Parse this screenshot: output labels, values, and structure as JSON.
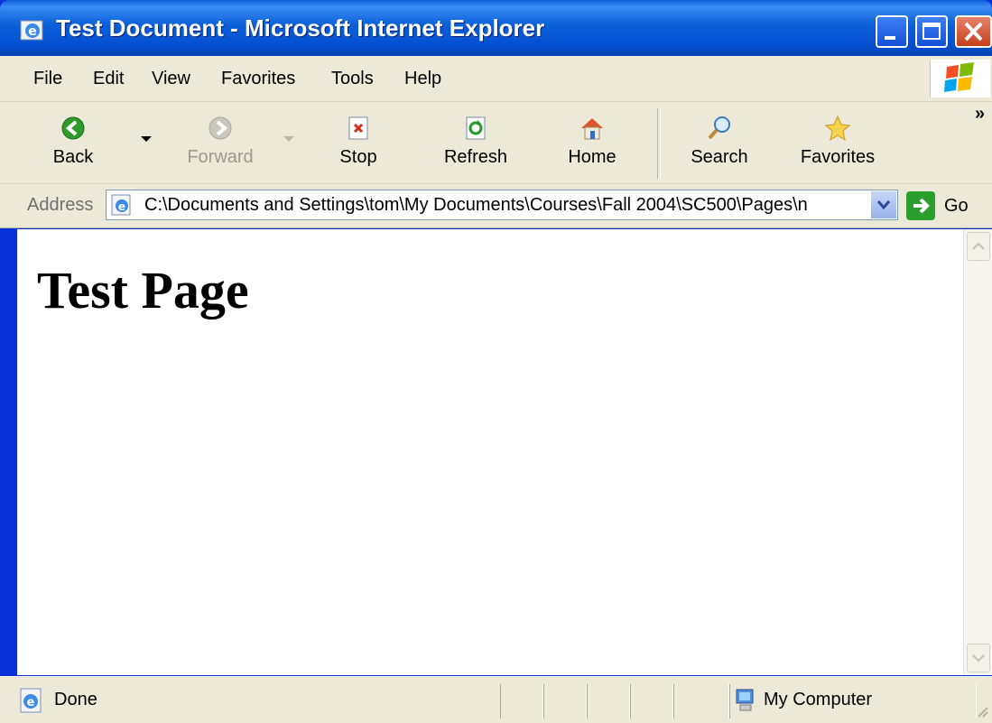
{
  "window": {
    "title": "Test Document - Microsoft Internet Explorer"
  },
  "menu": [
    "File",
    "Edit",
    "View",
    "Favorites",
    "Tools",
    "Help"
  ],
  "toolbar": {
    "back": "Back",
    "forward": "Forward",
    "stop": "Stop",
    "refresh": "Refresh",
    "home": "Home",
    "search": "Search",
    "favorites": "Favorites",
    "more": "»"
  },
  "address": {
    "label": "Address",
    "value": "C:\\Documents and Settings\\tom\\My Documents\\Courses\\Fall 2004\\SC500\\Pages\\n",
    "go": "Go"
  },
  "page": {
    "heading": "Test Page"
  },
  "status": {
    "text": "Done",
    "zone": "My Computer"
  }
}
